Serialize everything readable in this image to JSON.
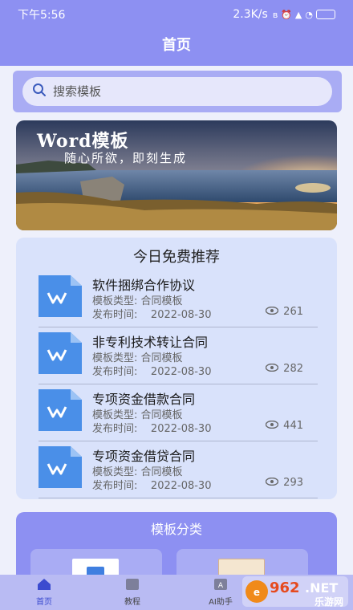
{
  "status_bar": {
    "time": "下午5:56",
    "network_speed": "2.3K/s"
  },
  "header": {
    "title": "首页"
  },
  "search": {
    "placeholder": "搜索模板"
  },
  "banner": {
    "title": "Word模板",
    "subtitle": "随心所欲，即刻生成"
  },
  "recommend": {
    "title": "今日免费推荐",
    "items": [
      {
        "name": "软件捆绑合作协议",
        "type": "模板类型: 合同模板",
        "date_label": "发布时间:",
        "date": "2022-08-30",
        "views": "261"
      },
      {
        "name": "非专利技术转让合同",
        "type": "模板类型: 合同模板",
        "date_label": "发布时间:",
        "date": "2022-08-30",
        "views": "282"
      },
      {
        "name": "专项资金借款合同",
        "type": "模板类型: 合同模板",
        "date_label": "发布时间:",
        "date": "2022-08-30",
        "views": "441"
      },
      {
        "name": "专项资金借贷合同",
        "type": "模板类型: 合同模板",
        "date_label": "发布时间:",
        "date": "2022-08-30",
        "views": "293"
      }
    ]
  },
  "categories": {
    "title": "模板分类"
  },
  "tabbar": {
    "tabs": [
      {
        "label": "首页",
        "icon": "home-icon",
        "active": true
      },
      {
        "label": "教程",
        "icon": "book-icon",
        "active": false
      },
      {
        "label": "AI助手",
        "icon": "ai-icon",
        "active": false
      },
      {
        "label": "",
        "icon": "",
        "active": false
      }
    ]
  },
  "watermark": {
    "text_number": "962",
    "text_net": ".NET",
    "text_cn": "乐游网"
  },
  "colors": {
    "primary": "#8d90f2",
    "card_bg": "#d9e2fb",
    "word_blue": "#4a8fe8",
    "accent_active": "#3b4bcf"
  }
}
